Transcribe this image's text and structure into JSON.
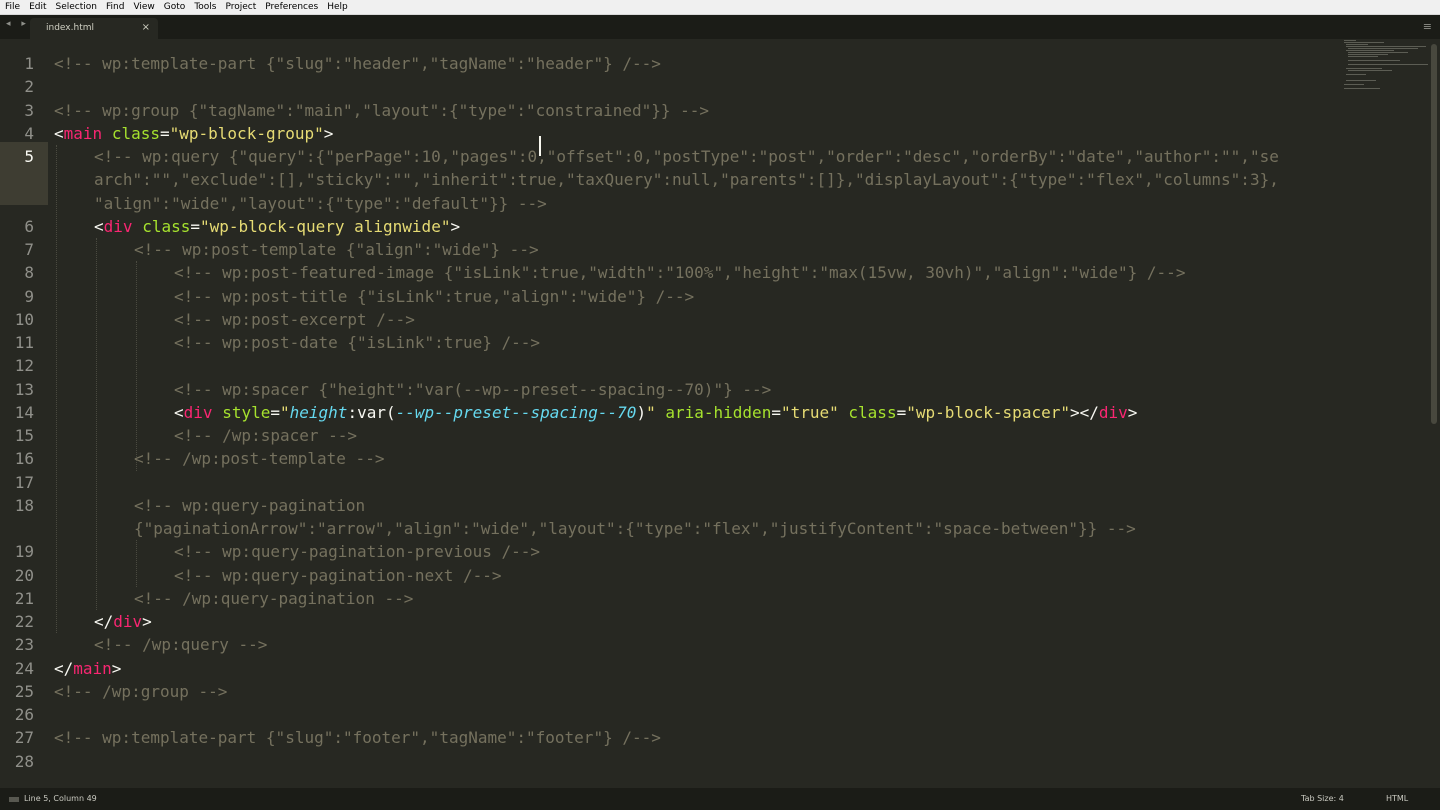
{
  "menu": [
    "File",
    "Edit",
    "Selection",
    "Find",
    "View",
    "Goto",
    "Tools",
    "Project",
    "Preferences",
    "Help"
  ],
  "tab": {
    "title": "index.html",
    "close": "×"
  },
  "icons": {
    "nav_arrows": "◂ ▸",
    "panel_menu": "≡"
  },
  "line_numbers": [
    "1",
    "2",
    "3",
    "4",
    "5",
    "6",
    "7",
    "8",
    "9",
    "10",
    "11",
    "12",
    "13",
    "14",
    "15",
    "16",
    "17",
    "18",
    "19",
    "20",
    "21",
    "22",
    "23",
    "24",
    "25",
    "26",
    "27",
    "28"
  ],
  "current_line": "5",
  "code": [
    {
      "ln": "1",
      "row": 0,
      "indent": 0,
      "segs": [
        {
          "c": "<!-- wp:template-part {\"slug\":\"header\",\"tagName\":\"header\"} /-->"
        }
      ]
    },
    {
      "ln": "3",
      "row": 2,
      "indent": 0,
      "segs": [
        {
          "c": "<!-- wp:group {\"tagName\":\"main\",\"layout\":{\"type\":\"constrained\"}} -->"
        }
      ]
    },
    {
      "ln": "4",
      "row": 3,
      "indent": 0,
      "segs": [
        {
          "w": "<"
        },
        {
          "t": "main"
        },
        {
          "w": " "
        },
        {
          "a": "class"
        },
        {
          "w": "="
        },
        {
          "s": "\"wp-block-group\""
        },
        {
          "w": ">"
        }
      ]
    },
    {
      "ln": "5",
      "row": 4,
      "indent": 1,
      "segs": [
        {
          "c": "<!-- wp:query {\"query\":{\"perPage\":10,\"pages\":0,\"offset\":0,\"postType\":\"post\",\"order\":\"desc\",\"orderBy\":\"date\",\"author\":\"\",\"se"
        }
      ]
    },
    {
      "ln": "",
      "row": 5,
      "indent": 1,
      "segs": [
        {
          "c": "arch\":\"\",\"exclude\":[],\"sticky\":\"\",\"inherit\":true,\"taxQuery\":null,\"parents\":[]},\"displayLayout\":{\"type\":\"flex\",\"columns\":3},"
        }
      ]
    },
    {
      "ln": "",
      "row": 6,
      "indent": 1,
      "segs": [
        {
          "c": "\"align\":\"wide\",\"layout\":{\"type\":\"default\"}} -->"
        }
      ]
    },
    {
      "ln": "6",
      "row": 7,
      "indent": 1,
      "segs": [
        {
          "w": "<"
        },
        {
          "t": "div"
        },
        {
          "w": " "
        },
        {
          "a": "class"
        },
        {
          "w": "="
        },
        {
          "s": "\"wp-block-query alignwide\""
        },
        {
          "w": ">"
        }
      ]
    },
    {
      "ln": "7",
      "row": 8,
      "indent": 2,
      "segs": [
        {
          "c": "<!-- wp:post-template {\"align\":\"wide\"} -->"
        }
      ]
    },
    {
      "ln": "8",
      "row": 9,
      "indent": 3,
      "segs": [
        {
          "c": "<!-- wp:post-featured-image {\"isLink\":true,\"width\":\"100%\",\"height\":\"max(15vw, 30vh)\",\"align\":\"wide\"} /-->"
        }
      ]
    },
    {
      "ln": "9",
      "row": 10,
      "indent": 3,
      "segs": [
        {
          "c": "<!-- wp:post-title {\"isLink\":true,\"align\":\"wide\"} /-->"
        }
      ]
    },
    {
      "ln": "10",
      "row": 11,
      "indent": 3,
      "segs": [
        {
          "c": "<!-- wp:post-excerpt /-->"
        }
      ]
    },
    {
      "ln": "11",
      "row": 12,
      "indent": 3,
      "segs": [
        {
          "c": "<!-- wp:post-date {\"isLink\":true} /-->"
        }
      ]
    },
    {
      "ln": "13",
      "row": 14,
      "indent": 3,
      "segs": [
        {
          "c": "<!-- wp:spacer {\"height\":\"var(--wp--preset--spacing--70)\"} -->"
        }
      ]
    },
    {
      "ln": "14",
      "row": 15,
      "indent": 3,
      "segs": [
        {
          "w": "<"
        },
        {
          "t": "div"
        },
        {
          "w": " "
        },
        {
          "a": "style"
        },
        {
          "w": "="
        },
        {
          "s": "\""
        },
        {
          "ci": "height"
        },
        {
          "w": ":var("
        },
        {
          "ci": "--wp--preset--spacing--70"
        },
        {
          "w": ")"
        },
        {
          "s": "\""
        },
        {
          "w": " "
        },
        {
          "a": "aria-hidden"
        },
        {
          "w": "="
        },
        {
          "s": "\"true\""
        },
        {
          "w": " "
        },
        {
          "a": "class"
        },
        {
          "w": "="
        },
        {
          "s": "\"wp-block-spacer\""
        },
        {
          "w": "></"
        },
        {
          "t": "div"
        },
        {
          "w": ">"
        }
      ]
    },
    {
      "ln": "15",
      "row": 16,
      "indent": 3,
      "segs": [
        {
          "c": "<!-- /wp:spacer -->"
        }
      ]
    },
    {
      "ln": "16",
      "row": 17,
      "indent": 2,
      "segs": [
        {
          "c": "<!-- /wp:post-template -->"
        }
      ]
    },
    {
      "ln": "18",
      "row": 19,
      "indent": 2,
      "segs": [
        {
          "c": "<!-- wp:query-pagination"
        }
      ]
    },
    {
      "ln": "",
      "row": 20,
      "indent": 2,
      "segs": [
        {
          "c": "{\"paginationArrow\":\"arrow\",\"align\":\"wide\",\"layout\":{\"type\":\"flex\",\"justifyContent\":\"space-between\"}} -->"
        }
      ]
    },
    {
      "ln": "19",
      "row": 21,
      "indent": 3,
      "segs": [
        {
          "c": "<!-- wp:query-pagination-previous /-->"
        }
      ]
    },
    {
      "ln": "20",
      "row": 22,
      "indent": 3,
      "segs": [
        {
          "c": "<!-- wp:query-pagination-next /-->"
        }
      ]
    },
    {
      "ln": "21",
      "row": 23,
      "indent": 2,
      "segs": [
        {
          "c": "<!-- /wp:query-pagination -->"
        }
      ]
    },
    {
      "ln": "22",
      "row": 24,
      "indent": 1,
      "segs": [
        {
          "w": "</"
        },
        {
          "t": "div"
        },
        {
          "w": ">"
        }
      ]
    },
    {
      "ln": "23",
      "row": 25,
      "indent": 1,
      "segs": [
        {
          "c": "<!-- /wp:query -->"
        }
      ]
    },
    {
      "ln": "24",
      "row": 26,
      "indent": 0,
      "segs": [
        {
          "w": "</"
        },
        {
          "t": "main"
        },
        {
          "w": ">"
        }
      ]
    },
    {
      "ln": "25",
      "row": 27,
      "indent": 0,
      "segs": [
        {
          "c": "<!-- /wp:group -->"
        }
      ]
    },
    {
      "ln": "27",
      "row": 29,
      "indent": 0,
      "segs": [
        {
          "c": "<!-- wp:template-part {\"slug\":\"footer\",\"tagName\":\"footer\"} /-->"
        }
      ]
    }
  ],
  "status": {
    "position": "Line 5, Column 49",
    "tab_size": "Tab Size: 4",
    "syntax": "HTML"
  }
}
